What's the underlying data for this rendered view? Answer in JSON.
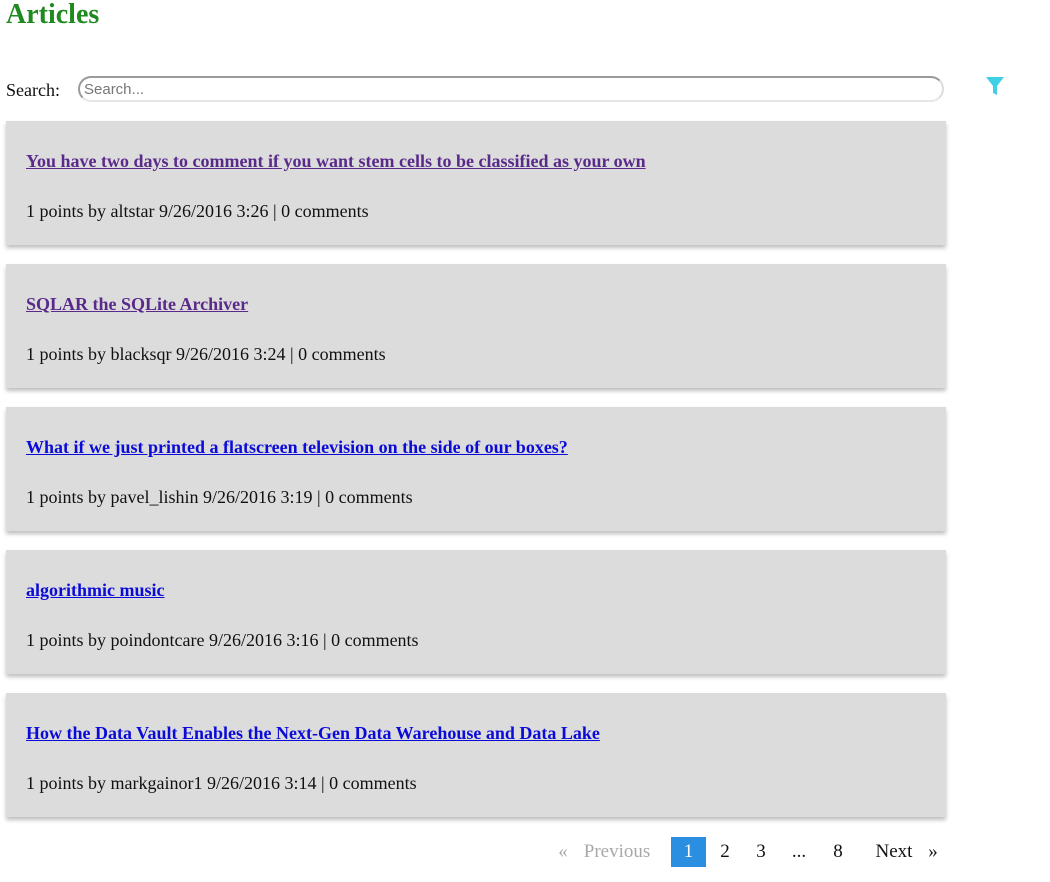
{
  "header": {
    "title": "Articles"
  },
  "search": {
    "label": "Search:",
    "placeholder": "Search...",
    "value": ""
  },
  "filter": {
    "icon": "filter-icon",
    "color": "#3fd0e6"
  },
  "articles": [
    {
      "title": "You have two days to comment if you want stem cells to be classified as your own",
      "meta": "1 points by altstar 9/26/2016 3:26 | 0 comments",
      "visited": true
    },
    {
      "title": "SQLAR the SQLite Archiver",
      "meta": "1 points by blacksqr 9/26/2016 3:24 | 0 comments",
      "visited": true
    },
    {
      "title": "What if we just printed a flatscreen television on the side of our boxes?",
      "meta": "1 points by pavel_lishin 9/26/2016 3:19 | 0 comments",
      "visited": false
    },
    {
      "title": "algorithmic music",
      "meta": "1 points by poindontcare 9/26/2016 3:16 | 0 comments",
      "visited": false
    },
    {
      "title": "How the Data Vault Enables the Next-Gen Data Warehouse and Data Lake",
      "meta": "1 points by markgainor1 9/26/2016 3:14 | 0 comments",
      "visited": false
    }
  ],
  "pagination": {
    "prev_arrow": "«",
    "prev_label": "Previous",
    "pages": [
      "1",
      "2",
      "3",
      "...",
      "8"
    ],
    "current": "1",
    "next_label": "Next",
    "next_arrow": "»",
    "active_color": "#2a8fe0"
  }
}
